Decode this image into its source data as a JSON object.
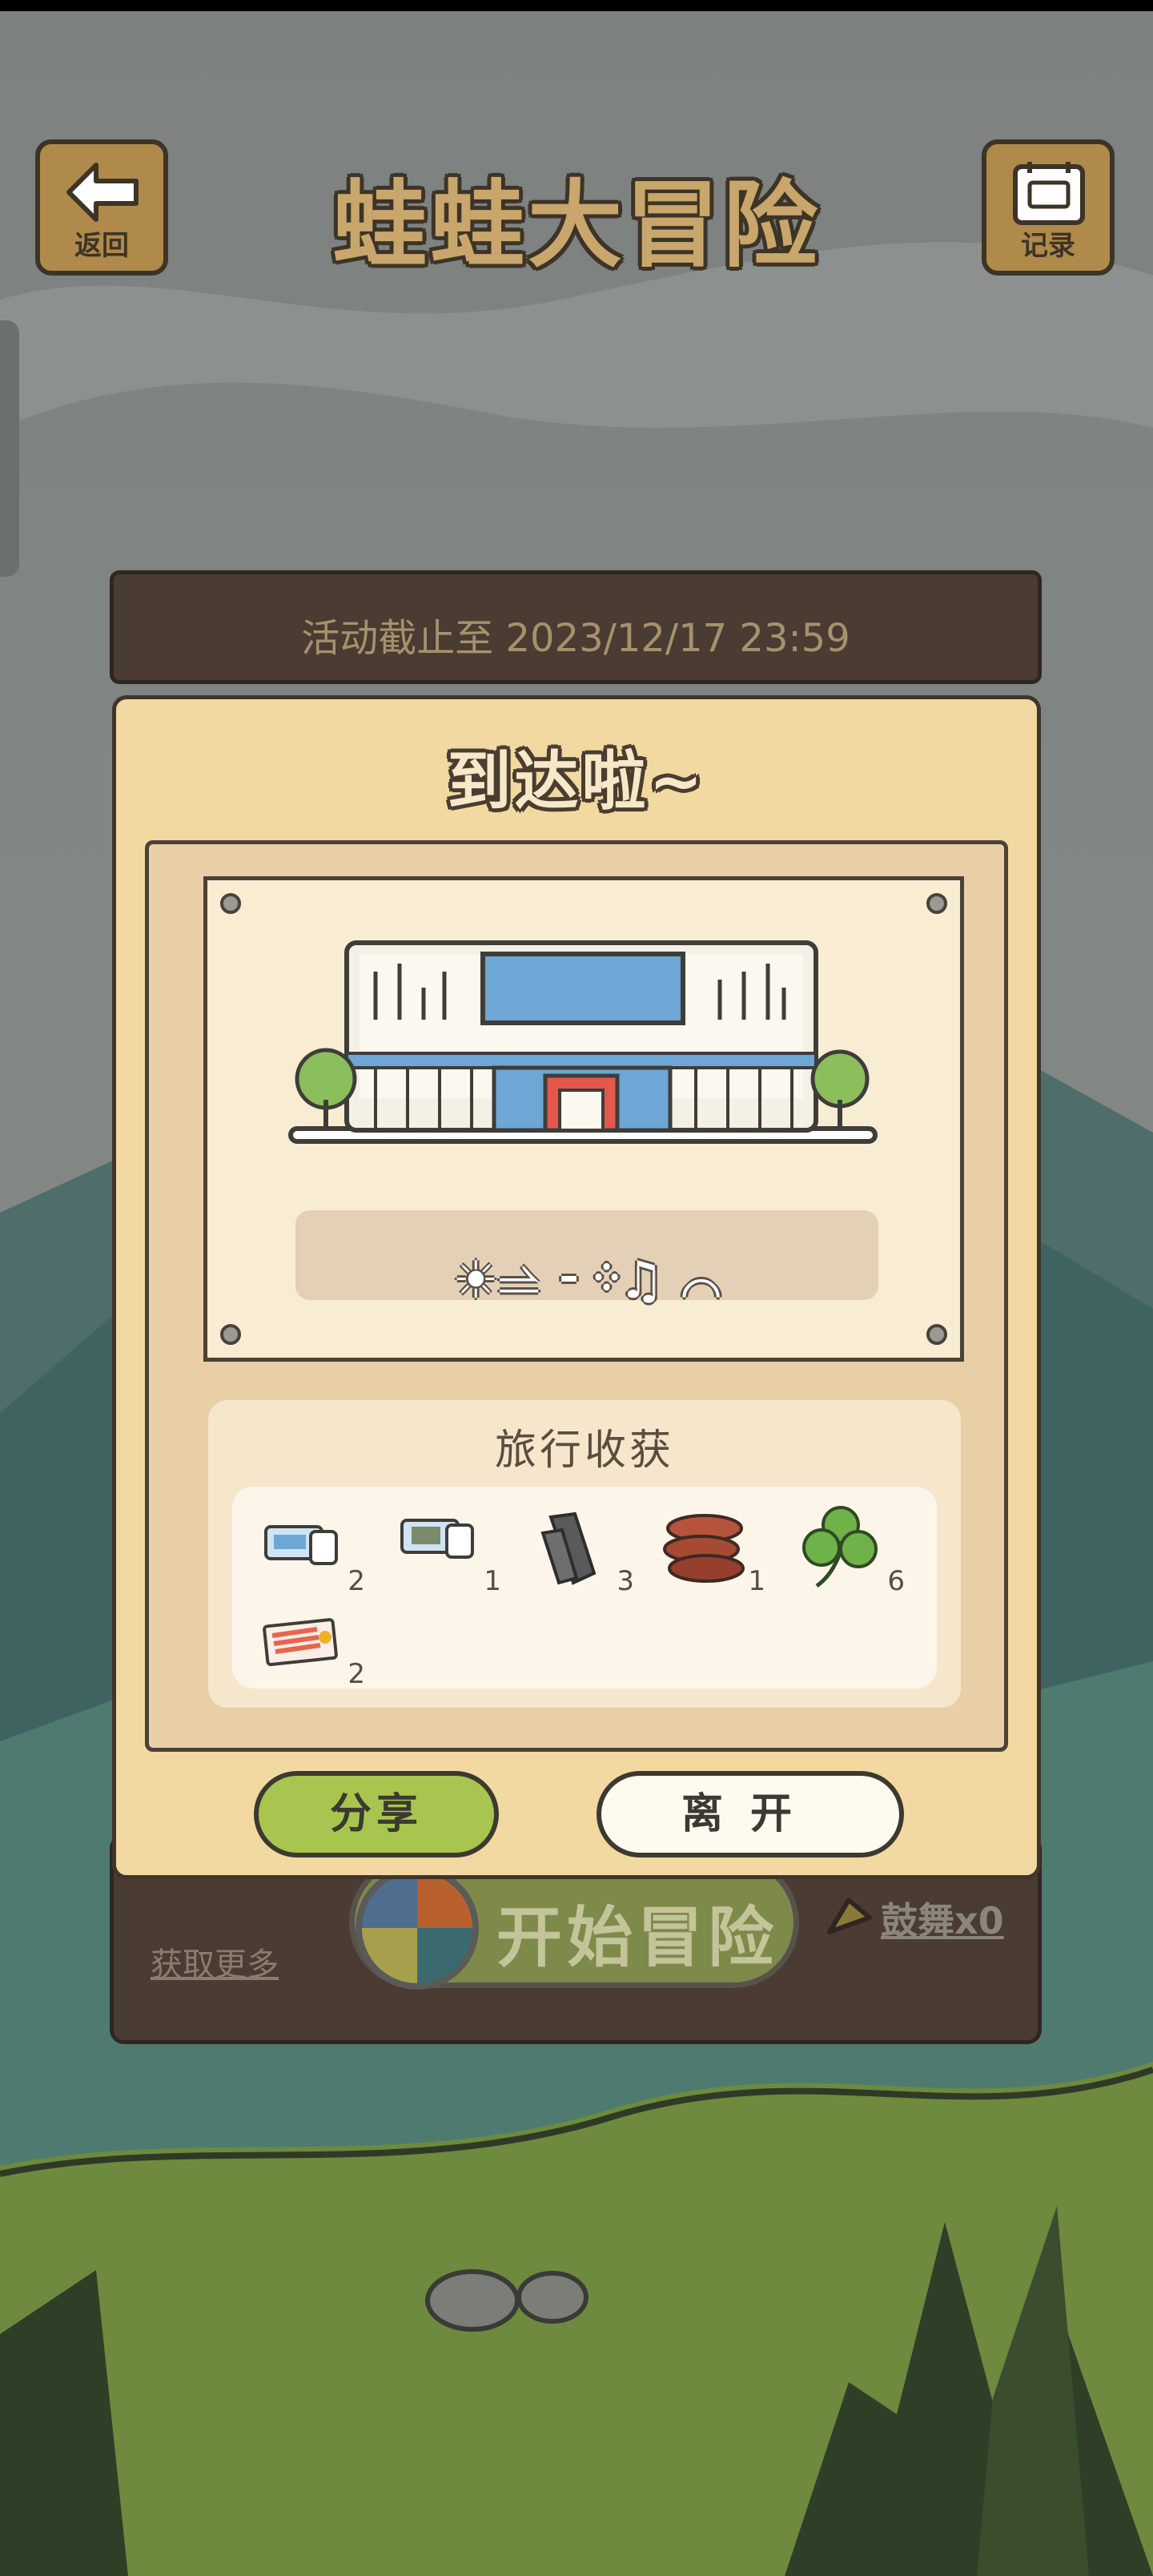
{
  "header": {
    "back_label": "返回",
    "game_title": "蛙蛙大冒险",
    "record_label": "记录"
  },
  "event": {
    "deadline_text": "活动截止至 2023/12/17 23:59"
  },
  "dialog": {
    "title": "到达啦~",
    "phrase": "☀⥬ ⁃᠅♫ ⌒",
    "harvest_title": "旅行收获",
    "items": [
      {
        "icon": "ticket-icon",
        "count": "2"
      },
      {
        "icon": "ticket-icon",
        "count": "1"
      },
      {
        "icon": "wood-icon",
        "count": "3"
      },
      {
        "icon": "sausage-icon",
        "count": "1"
      },
      {
        "icon": "clover-icon",
        "count": "6"
      },
      {
        "icon": "postcard-icon",
        "count": "2"
      }
    ],
    "share_label": "分享",
    "leave_label": "离开"
  },
  "bottom": {
    "get_more": "获取更多",
    "start_label": "开始冒险",
    "drum_label": "鼓舞x0"
  }
}
